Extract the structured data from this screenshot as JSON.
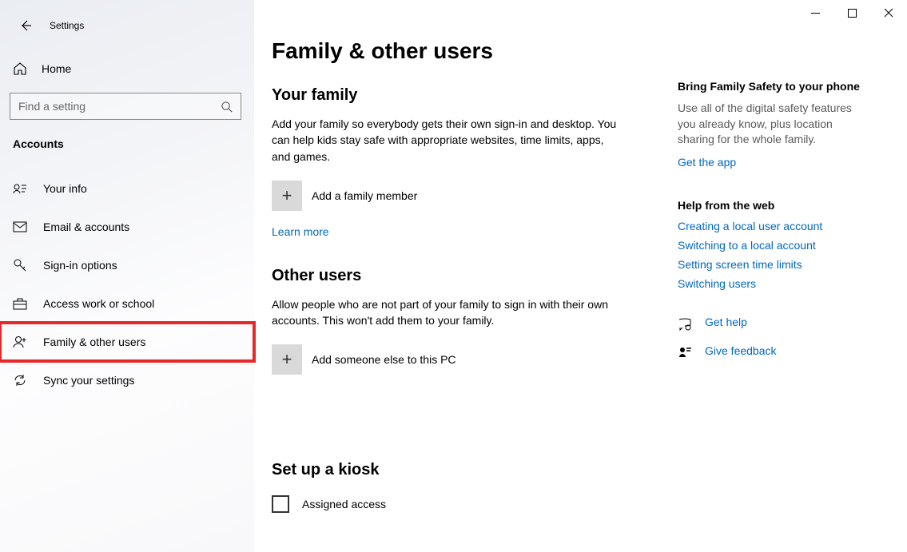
{
  "app": {
    "title": "Settings"
  },
  "sidebar": {
    "home": "Home",
    "search_placeholder": "Find a setting",
    "section": "Accounts",
    "items": [
      {
        "label": "Your info"
      },
      {
        "label": "Email & accounts"
      },
      {
        "label": "Sign-in options"
      },
      {
        "label": "Access work or school"
      },
      {
        "label": "Family & other users"
      },
      {
        "label": "Sync your settings"
      }
    ]
  },
  "main": {
    "title": "Family & other users",
    "family": {
      "heading": "Your family",
      "desc": "Add your family so everybody gets their own sign-in and desktop. You can help kids stay safe with appropriate websites, time limits, apps, and games.",
      "add_label": "Add a family member",
      "learn_more": "Learn more"
    },
    "others": {
      "heading": "Other users",
      "desc": "Allow people who are not part of your family to sign in with their own accounts. This won't add them to your family.",
      "add_label": "Add someone else to this PC"
    },
    "kiosk": {
      "heading": "Set up a kiosk",
      "assigned": "Assigned access"
    }
  },
  "rail": {
    "promo": {
      "title": "Bring Family Safety to your phone",
      "desc": "Use all of the digital safety features you already know, plus location sharing for the whole family.",
      "link": "Get the app"
    },
    "help": {
      "title": "Help from the web",
      "links": [
        "Creating a local user account",
        "Switching to a local account",
        "Setting screen time limits",
        "Switching users"
      ]
    },
    "gethelp": "Get help",
    "feedback": "Give feedback"
  }
}
